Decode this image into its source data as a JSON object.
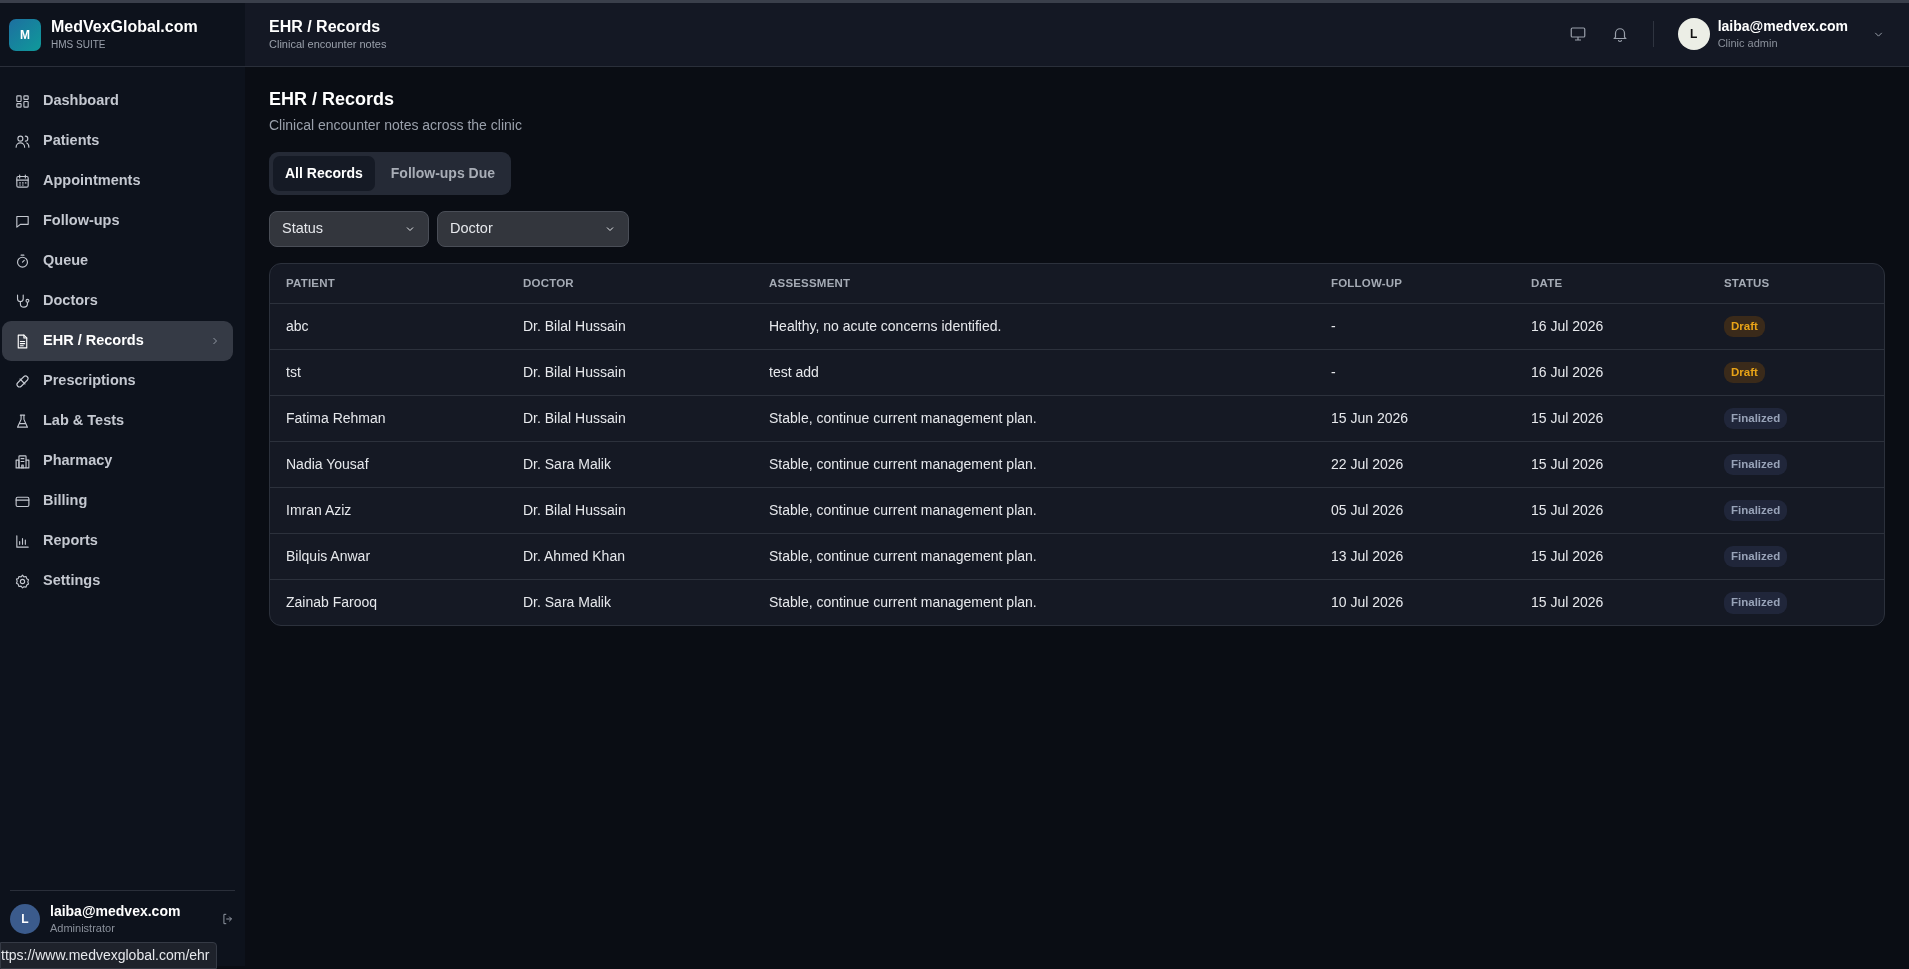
{
  "brand": {
    "name": "MedVexGlobal.com",
    "subtitle": "HMS SUITE",
    "logo_letter": "M"
  },
  "sidebar": {
    "items": [
      {
        "label": "Dashboard",
        "selected": false
      },
      {
        "label": "Patients",
        "selected": false
      },
      {
        "label": "Appointments",
        "selected": false
      },
      {
        "label": "Follow-ups",
        "selected": false
      },
      {
        "label": "Queue",
        "selected": false
      },
      {
        "label": "Doctors",
        "selected": false
      },
      {
        "label": "EHR / Records",
        "selected": true
      },
      {
        "label": "Prescriptions",
        "selected": false
      },
      {
        "label": "Lab & Tests",
        "selected": false
      },
      {
        "label": "Pharmacy",
        "selected": false
      },
      {
        "label": "Billing",
        "selected": false
      },
      {
        "label": "Reports",
        "selected": false
      },
      {
        "label": "Settings",
        "selected": false
      }
    ],
    "user": {
      "initial": "L",
      "email": "laiba@medvex.com",
      "role": "Administrator"
    }
  },
  "header": {
    "title": "EHR / Records",
    "subtitle": "Clinical encounter notes",
    "user": {
      "initial": "L",
      "email": "laiba@medvex.com",
      "role": "Clinic admin"
    }
  },
  "page": {
    "title": "EHR / Records",
    "subtitle": "Clinical encounter notes across the clinic"
  },
  "tabs": [
    {
      "label": "All Records",
      "selected": true
    },
    {
      "label": "Follow-ups Due",
      "selected": false
    }
  ],
  "filters": [
    {
      "label": "Status"
    },
    {
      "label": "Doctor"
    }
  ],
  "table": {
    "columns": [
      "PATIENT",
      "DOCTOR",
      "ASSESSMENT",
      "FOLLOW-UP",
      "DATE",
      "STATUS"
    ],
    "rows": [
      {
        "patient": "abc",
        "doctor": "Dr. Bilal Hussain",
        "assessment": "Healthy, no acute concerns identified.",
        "follow_up": "-",
        "date": "16 Jul 2026",
        "status": {
          "label": "Draft",
          "kind": "draft"
        }
      },
      {
        "patient": "tst",
        "doctor": "Dr. Bilal Hussain",
        "assessment": "test add",
        "follow_up": "-",
        "date": "16 Jul 2026",
        "status": {
          "label": "Draft",
          "kind": "draft"
        }
      },
      {
        "patient": "Fatima Rehman",
        "doctor": "Dr. Bilal Hussain",
        "assessment": "Stable, continue current management plan.",
        "follow_up": "15 Jun 2026",
        "date": "15 Jul 2026",
        "status": {
          "label": "Finalized",
          "kind": "finalized"
        }
      },
      {
        "patient": "Nadia Yousaf",
        "doctor": "Dr. Sara Malik",
        "assessment": "Stable, continue current management plan.",
        "follow_up": "22 Jul 2026",
        "date": "15 Jul 2026",
        "status": {
          "label": "Finalized",
          "kind": "finalized"
        }
      },
      {
        "patient": "Imran Aziz",
        "doctor": "Dr. Bilal Hussain",
        "assessment": "Stable, continue current management plan.",
        "follow_up": "05 Jul 2026",
        "date": "15 Jul 2026",
        "status": {
          "label": "Finalized",
          "kind": "finalized"
        }
      },
      {
        "patient": "Bilquis Anwar",
        "doctor": "Dr. Ahmed Khan",
        "assessment": "Stable, continue current management plan.",
        "follow_up": "13 Jul 2026",
        "date": "15 Jul 2026",
        "status": {
          "label": "Finalized",
          "kind": "finalized"
        }
      },
      {
        "patient": "Zainab Farooq",
        "doctor": "Dr. Sara Malik",
        "assessment": "Stable, continue current management plan.",
        "follow_up": "10 Jul 2026",
        "date": "15 Jul 2026",
        "status": {
          "label": "Finalized",
          "kind": "finalized"
        }
      }
    ]
  },
  "browser_status_url": "ttps://www.medvexglobal.com/ehr"
}
